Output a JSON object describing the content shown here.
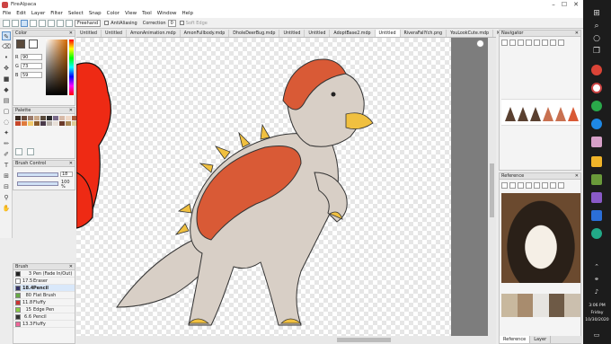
{
  "window": {
    "title": "FireAlpaca",
    "min": "–",
    "max": "☐",
    "close": "✕"
  },
  "menu": [
    "File",
    "Edit",
    "Layer",
    "Filter",
    "Select",
    "Snap",
    "Color",
    "View",
    "Tool",
    "Window",
    "Help"
  ],
  "toolbar": {
    "mode": "Freehand",
    "antialiasing_label": "AntiAliasing",
    "correction_label": "Correction",
    "correction_value": "0",
    "soft_edge_label": "Soft Edge"
  },
  "color_panel": {
    "title": "Color",
    "r_label": "R",
    "r_value": "90",
    "g_label": "G",
    "g_value": "73",
    "b_label": "B",
    "b_value": "59",
    "primary_color": "#5a4a3b",
    "secondary_color": "#ffffff"
  },
  "palette_panel": {
    "title": "Palette",
    "colors": [
      "#3a2a22",
      "#6a4a3a",
      "#9a7a6a",
      "#c9a98a",
      "#5a4a3b",
      "#2a2a2a",
      "#7a6a8a",
      "#d7b9a7",
      "#f0d9c8",
      "#a85a3a",
      "#c7472a",
      "#e07b3c",
      "#f2c96c",
      "#8a5a2a",
      "#4a3a4a",
      "#b8b0a8",
      "#e8e0d8",
      "#6a3a2a",
      "#aa8855",
      "#ddcc99"
    ]
  },
  "brush_control": {
    "title": "Brush Control",
    "size_value": "18",
    "opacity_value": "100 %"
  },
  "brush_panel": {
    "title": "Brush",
    "items": [
      {
        "size": "3",
        "name": "Pen (Fade In/Out)",
        "color": "#222222"
      },
      {
        "size": "17.5",
        "name": "Eraser",
        "color": "#ffffff"
      },
      {
        "size": "18.4",
        "name": "Pencil",
        "color": "#333366"
      },
      {
        "size": "80",
        "name": "Flat Brush",
        "color": "#66aa44"
      },
      {
        "size": "11.8",
        "name": "Fluffy",
        "color": "#cc3333"
      },
      {
        "size": "15",
        "name": "Edge Pen",
        "color": "#88cc44"
      },
      {
        "size": "6.6",
        "name": "Pencil",
        "color": "#333333"
      },
      {
        "size": "13.3",
        "name": "Fluffy",
        "color": "#ee6699"
      }
    ]
  },
  "tabs": [
    "Untitled",
    "Untitled",
    "AmonAnimation.mdp",
    "AmonFullbody.mdp",
    "DholeDeerBug.mdp",
    "Untitled",
    "Untitled",
    "AdoptBase2.mdp",
    "Untitled",
    "RiveraFallYch.png",
    "YouLookCute.mdp",
    "KazYch.png"
  ],
  "navigator_panel": {
    "title": "Navigator"
  },
  "reference_panel": {
    "title": "Reference"
  },
  "bottom_tabs": [
    "Reference",
    "Layer"
  ],
  "clock": {
    "time": "3:06 PM",
    "day": "Friday",
    "date": "10/30/2020"
  }
}
